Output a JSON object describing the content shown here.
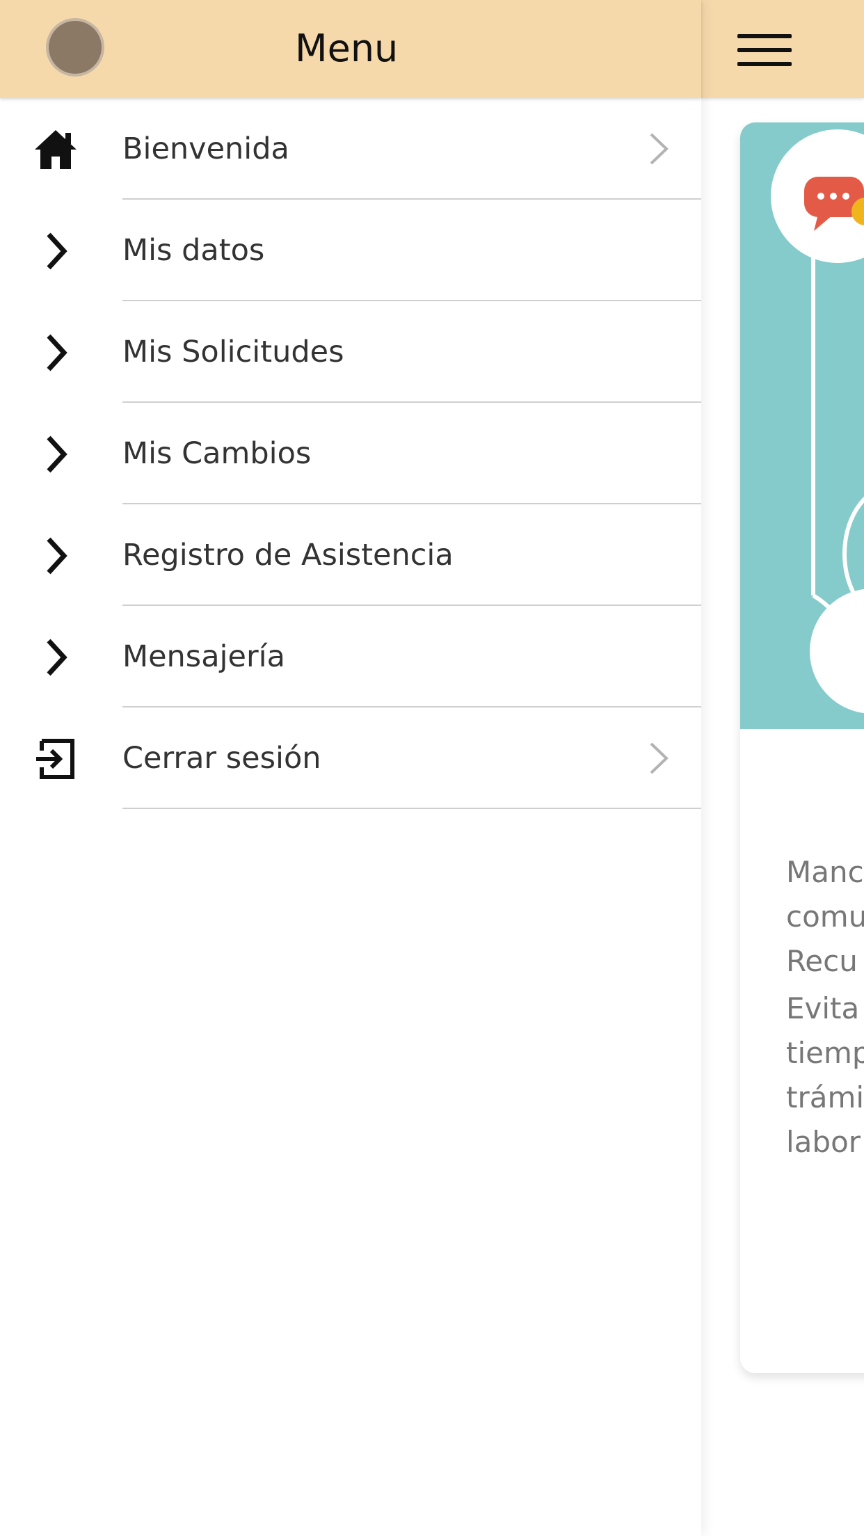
{
  "drawer": {
    "title": "Menu",
    "items": [
      {
        "label": "Bienvenida",
        "lead_icon": "home-icon",
        "trail_icon": "chevron-right-icon"
      },
      {
        "label": "Mis datos",
        "lead_icon": "chevron-right-icon"
      },
      {
        "label": "Mis Solicitudes",
        "lead_icon": "chevron-right-icon"
      },
      {
        "label": "Mis Cambios",
        "lead_icon": "chevron-right-icon"
      },
      {
        "label": "Registro de Asistencia",
        "lead_icon": "chevron-right-icon"
      },
      {
        "label": "Mensajería",
        "lead_icon": "chevron-right-icon"
      },
      {
        "label": "Cerrar sesión",
        "lead_icon": "logout-icon",
        "trail_icon": "chevron-right-icon"
      }
    ]
  },
  "header": {
    "menu_icon": "hamburger-icon"
  },
  "card": {
    "text_lines": [
      "Manc",
      "comu",
      "Recu"
    ],
    "text_lines_2": [
      "Evita",
      "tiemp",
      "trámi",
      "labor"
    ]
  },
  "colors": {
    "header_bg": "#f6d9ab",
    "illustration_bg": "#86cbcb",
    "bubble_red": "#e35b47",
    "bubble_yellow": "#f0b51c"
  }
}
